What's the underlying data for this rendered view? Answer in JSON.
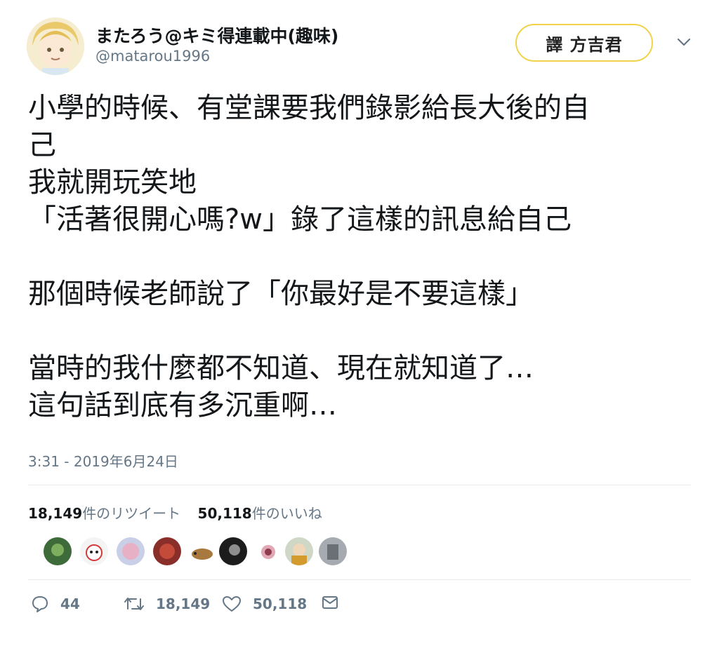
{
  "user": {
    "name": "またろう@キミ得連載中(趣味)",
    "handle": "@matarou1996"
  },
  "badge": {
    "label": "譯 方吉君"
  },
  "tweet": {
    "lines": [
      "小學的時候、有堂課要我們錄影給長大後的自",
      "己",
      "我就開玩笑地",
      "「活著很開心嗎?w」錄了這樣的訊息給自己",
      "",
      "那個時候老師說了「你最好是不要這樣」",
      "",
      "當時的我什麼都不知道、現在就知道了…",
      "這句話到底有多沉重啊…"
    ]
  },
  "timestamp": "3:31 - 2019年6月24日",
  "stats": {
    "retweets_count": "18,149",
    "retweets_label": "件のリツイート",
    "likes_count": "50,118",
    "likes_label": "件のいいね"
  },
  "actions": {
    "replies": "44",
    "retweets": "18,149",
    "likes": "50,118"
  },
  "colors": {
    "text": "#14171a",
    "secondary": "#657786",
    "divider": "#e6ecf0",
    "badge_border": "#f2d24a"
  }
}
